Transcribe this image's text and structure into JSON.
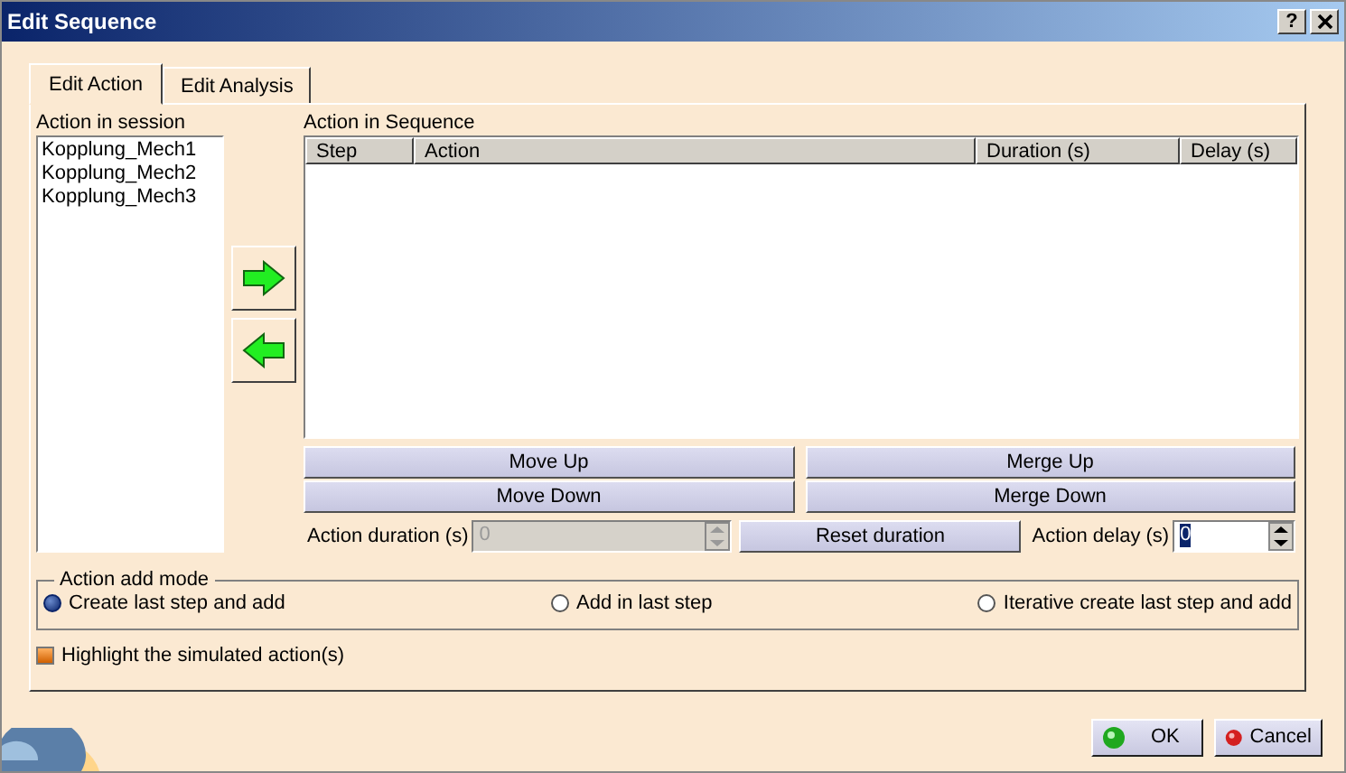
{
  "window": {
    "title": "Edit Sequence",
    "help": "?"
  },
  "tabs": [
    {
      "label": "Edit Action",
      "selected": true
    },
    {
      "label": "Edit Analysis",
      "selected": false
    }
  ],
  "session": {
    "label": "Action in session",
    "items": [
      "Kopplung_Mech1",
      "Kopplung_Mech2",
      "Kopplung_Mech3"
    ]
  },
  "sequence": {
    "label": "Action in Sequence",
    "columns": [
      "Step",
      "Action",
      "Duration (s)",
      "Delay (s)"
    ]
  },
  "move_buttons": [
    "Move Up",
    "Move Down"
  ],
  "merge_buttons": [
    "Merge Up",
    "Merge Down"
  ],
  "duration": {
    "label": "Action duration (s)",
    "value": "0",
    "disabled": true
  },
  "reset_button": "Reset duration",
  "delay": {
    "label": "Action delay (s)",
    "value": "0",
    "focused": true
  },
  "add_mode": {
    "label": "Action add mode",
    "options": [
      {
        "label": "Create last step and add",
        "selected": true
      },
      {
        "label": "Add in last step",
        "selected": false
      },
      {
        "label": "Iterative create last step and add",
        "selected": false
      }
    ]
  },
  "highlight": {
    "label": "Highlight the simulated action(s)",
    "checked": true
  },
  "ok": "OK",
  "cancel": "Cancel"
}
